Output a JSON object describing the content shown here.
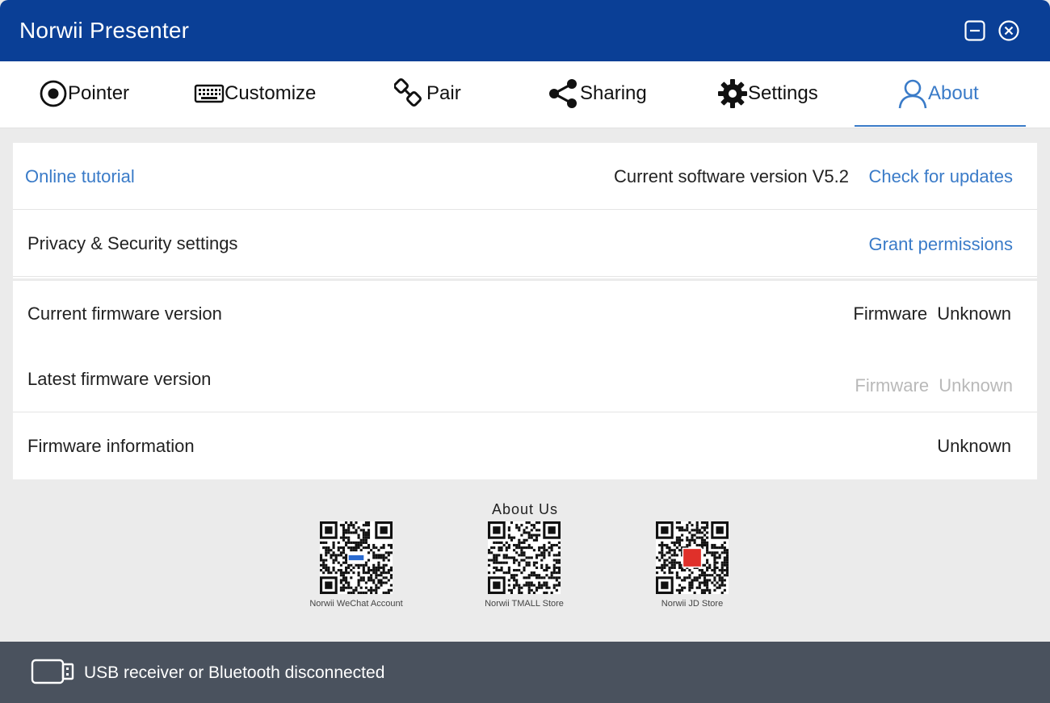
{
  "window": {
    "title": "Norwii Presenter",
    "minimize_icon": "minimize-icon",
    "close_icon": "close-icon",
    "colors": {
      "titlebar": "#0a3f96",
      "accent": "#3a7bc8",
      "statusbar": "#4a525e"
    }
  },
  "tabs": [
    {
      "label": "Pointer",
      "icon": "pointer-icon"
    },
    {
      "label": "Customize",
      "icon": "keyboard-icon"
    },
    {
      "label": "Pair",
      "icon": "link-icon"
    },
    {
      "label": "Sharing",
      "icon": "share-icon"
    },
    {
      "label": "Settings",
      "icon": "gear-icon"
    },
    {
      "label": "About",
      "icon": "user-icon",
      "active": true
    }
  ],
  "rows": {
    "tutorial": {
      "link": "Online tutorial",
      "version_text": "Current software version V5.2",
      "update_link": "Check for updates"
    },
    "privacy": {
      "label": "Privacy & Security settings",
      "link": "Grant permissions"
    },
    "current_fw": {
      "label": "Current firmware version",
      "value": "Firmware  Unknown"
    },
    "latest_fw": {
      "label": "Latest firmware version",
      "value": "Firmware  Unknown"
    },
    "fw_info": {
      "label": "Firmware information",
      "value": "Unknown"
    }
  },
  "about": {
    "title": "About Us",
    "qrcodes": [
      {
        "caption": "Norwii WeChat Account"
      },
      {
        "caption": "Norwii TMALL Store"
      },
      {
        "caption": "Norwii JD Store"
      }
    ]
  },
  "status": {
    "icon": "usb-icon",
    "text": "USB receiver or Bluetooth disconnected"
  }
}
